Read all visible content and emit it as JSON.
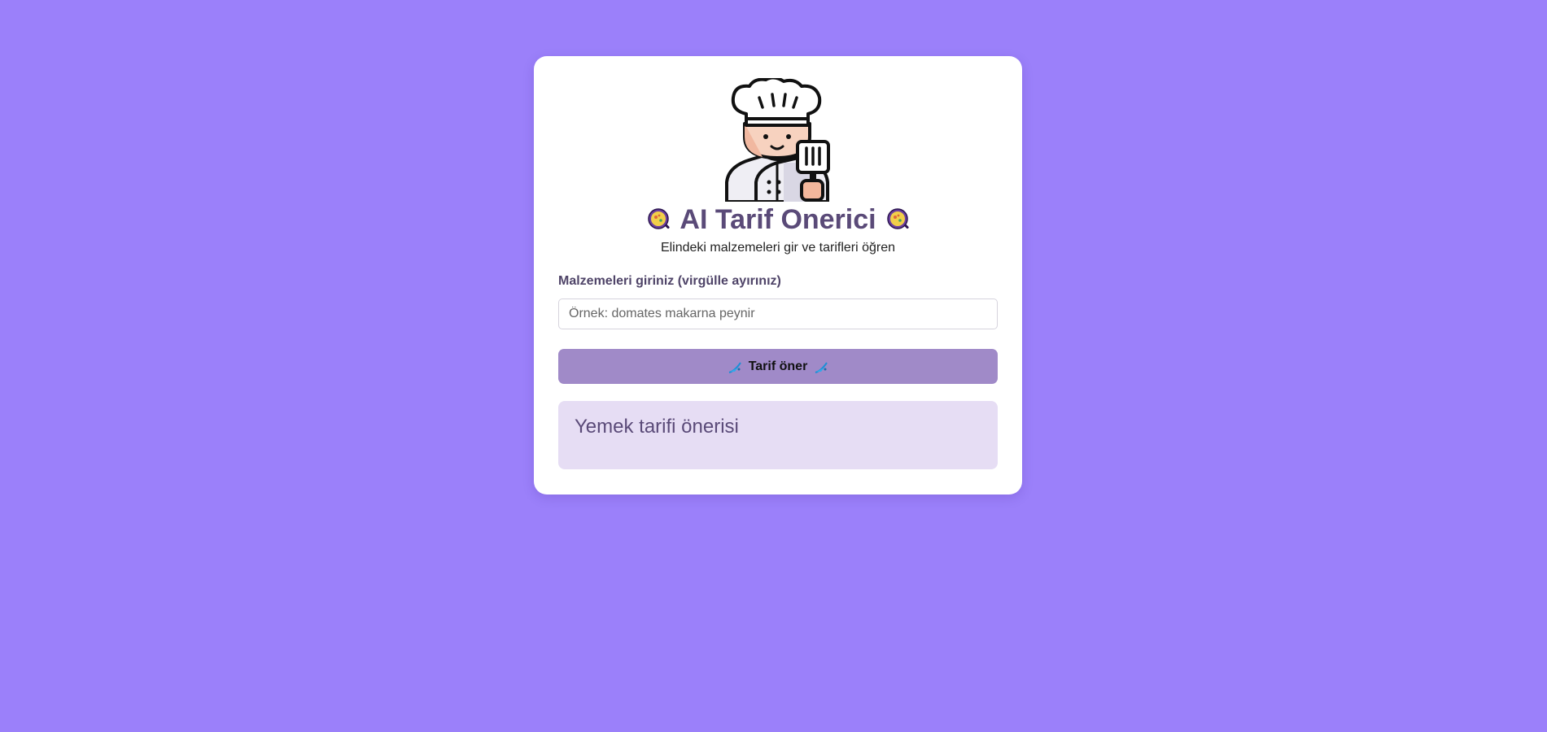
{
  "app": {
    "title": "AI Tarif Onerici",
    "subtitle": "Elindeki malzemeleri gir ve tarifleri öğren",
    "logo_icon": "chef-icon",
    "title_icon": "paella-icon"
  },
  "form": {
    "ingredients_label": "Malzemeleri giriniz (virgülle ayırınız)",
    "ingredients_value": "",
    "ingredients_placeholder": "Örnek: domates makarna peynir",
    "submit_label": "Tarif öner",
    "submit_icon": "fishing-pole-icon"
  },
  "result": {
    "heading": "Yemek tarifi önerisi"
  },
  "colors": {
    "background": "#9b80fa",
    "card": "#ffffff",
    "title": "#5a4a78",
    "button": "#a08ac8",
    "result_box": "#e6ddf4"
  }
}
